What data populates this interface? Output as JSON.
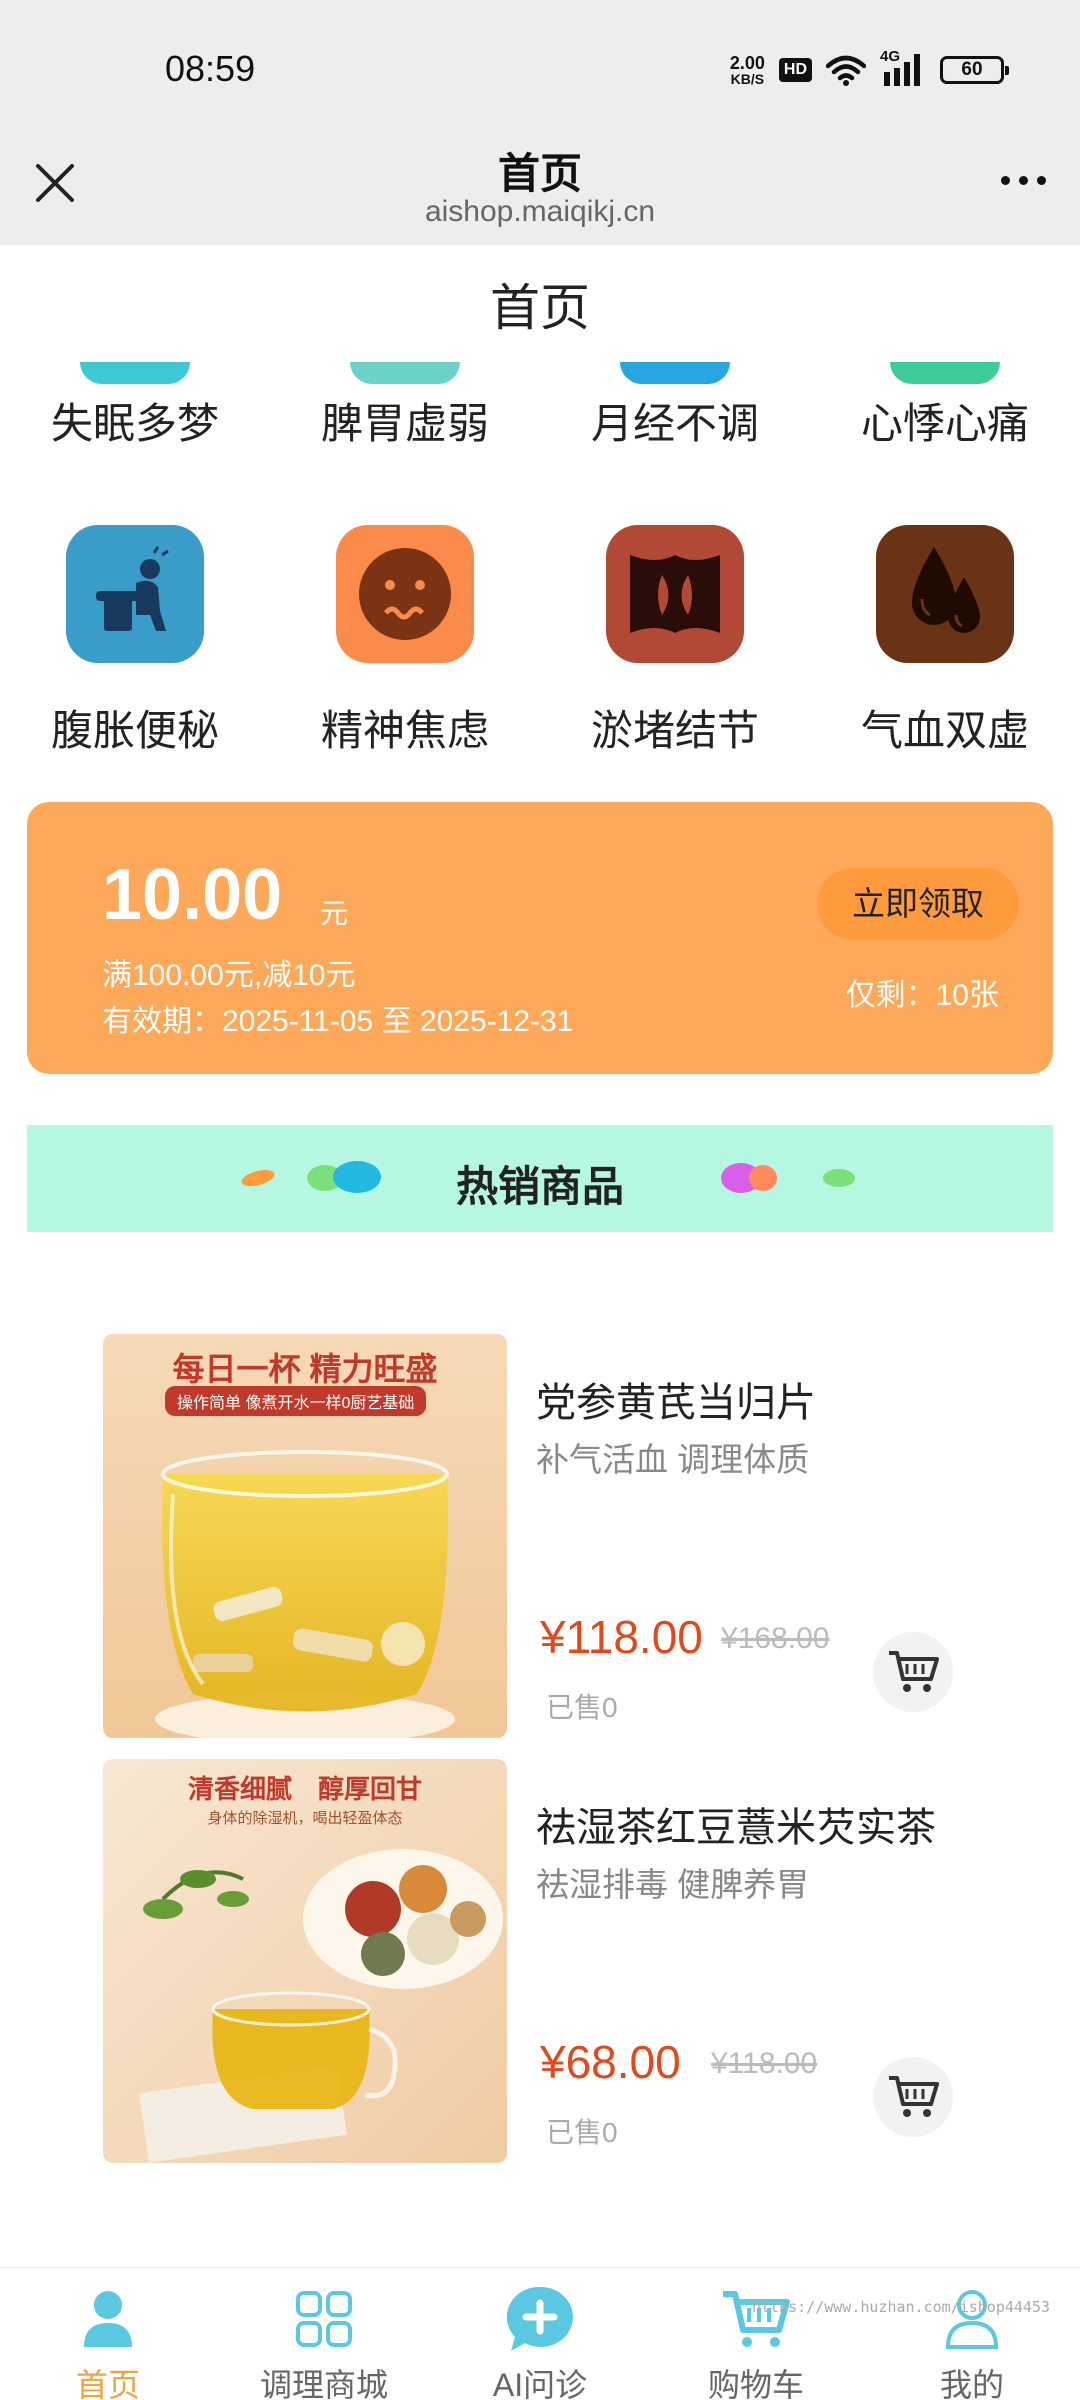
{
  "status_bar": {
    "time": "08:59",
    "speed_value": "2.00",
    "speed_unit": "KB/S",
    "hd": "HD",
    "network": "4G",
    "battery": "60"
  },
  "header": {
    "title": "首页",
    "url": "aishop.maiqikj.cn",
    "close_icon": "close-icon",
    "more_icon": "more-dots-icon"
  },
  "page_title": "首页",
  "categories_row1": [
    {
      "label": "失眠多梦",
      "color": "#3cc9d4"
    },
    {
      "label": "脾胃虚弱",
      "color": "#6ad2c8"
    },
    {
      "label": "月经不调",
      "color": "#27a6e0"
    },
    {
      "label": "心悸心痛",
      "color": "#3ecb98"
    }
  ],
  "categories_row2": [
    {
      "label": "腹胀便秘",
      "color": "#3a9cc9",
      "icon": "toilet-person-icon"
    },
    {
      "label": "精神焦虑",
      "color": "#fa8b4a",
      "icon": "worried-face-icon"
    },
    {
      "label": "淤堵结节",
      "color": "#b24836",
      "icon": "blockage-icon"
    },
    {
      "label": "气血双虚",
      "color": "#6b3316",
      "icon": "drops-icon"
    }
  ],
  "coupon": {
    "amount": "10.00",
    "unit": "元",
    "condition": "满100.00元,减10元",
    "validity": "有效期：2025-11-05 至 2025-12-31",
    "button": "立即领取",
    "remaining": "仅剩：10张"
  },
  "hot_section": {
    "title": "热销商品"
  },
  "products": [
    {
      "name": "党参黄芪当归片",
      "desc": "补气活血 调理体质",
      "price": "¥118.00",
      "original_price": "¥168.00",
      "sold": "已售0",
      "image_caption": "每日一杯 精力旺盛",
      "image_subcaption": "操作简单 像煮开水一样0厨艺基础"
    },
    {
      "name": "祛湿茶红豆薏米芡实茶",
      "desc": "祛湿排毒 健脾养胃",
      "price": "¥68.00",
      "original_price": "¥118.00",
      "sold": "已售0",
      "image_caption": "清香细腻　醇厚回甘",
      "image_subcaption": "身体的除湿机，喝出轻盈体态"
    }
  ],
  "tabs": [
    {
      "label": "首页",
      "icon": "home-person-icon",
      "active": true
    },
    {
      "label": "调理商城",
      "icon": "grid-icon",
      "active": false
    },
    {
      "label": "AI问诊",
      "icon": "chat-plus-icon",
      "active": false
    },
    {
      "label": "购物车",
      "icon": "cart-icon",
      "active": false
    },
    {
      "label": "我的",
      "icon": "user-icon",
      "active": false
    }
  ],
  "colors": {
    "accent": "#f0a43e",
    "coupon_bg": "#fea85a",
    "hot_banner_bg": "#b6f7e2",
    "price": "#e3481c",
    "tab_icon": "#5ac8e0"
  },
  "watermark": "https://www.huzhan.com/ishop44453"
}
